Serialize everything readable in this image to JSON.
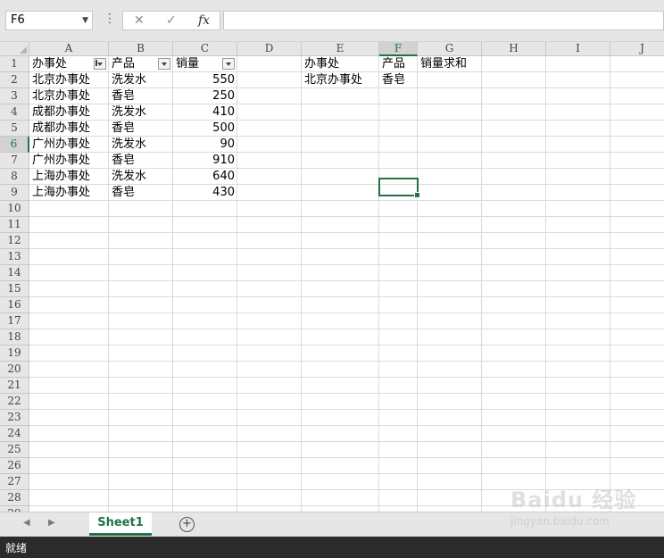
{
  "formula_bar": {
    "name_box": "F6",
    "cancel_icon": "✕",
    "enter_icon": "✓",
    "fx_label": "fx",
    "formula_value": ""
  },
  "columns": [
    "A",
    "B",
    "C",
    "D",
    "E",
    "F",
    "G",
    "H",
    "I",
    "J"
  ],
  "active_column": "F",
  "rows": [
    "1",
    "2",
    "3",
    "4",
    "5",
    "6",
    "7",
    "8",
    "9",
    "10",
    "11",
    "12",
    "13",
    "14",
    "15",
    "16",
    "17",
    "18",
    "19",
    "20",
    "21",
    "22",
    "23",
    "24",
    "25",
    "26",
    "27",
    "28",
    "29"
  ],
  "active_row": "6",
  "selected_cell": "F6",
  "table": {
    "headers": [
      "办事处",
      "产品",
      "销量"
    ],
    "rows": [
      [
        "北京办事处",
        "洗发水",
        "550"
      ],
      [
        "北京办事处",
        "香皂",
        "250"
      ],
      [
        "成都办事处",
        "洗发水",
        "410"
      ],
      [
        "成都办事处",
        "香皂",
        "500"
      ],
      [
        "广州办事处",
        "洗发水",
        "90"
      ],
      [
        "广州办事处",
        "香皂",
        "910"
      ],
      [
        "上海办事处",
        "洗发水",
        "640"
      ],
      [
        "上海办事处",
        "香皂",
        "430"
      ]
    ]
  },
  "criteria": {
    "headers": [
      "办事处",
      "产品",
      "销量求和"
    ],
    "row": [
      "北京办事处",
      "香皂",
      ""
    ]
  },
  "sheet_tabs": [
    {
      "label": "Sheet1",
      "active": true
    }
  ],
  "status_bar": {
    "text": "就绪"
  },
  "watermark": {
    "logo": "Baidu 经验",
    "url": "jingyan.baidu.com"
  },
  "colors": {
    "accent": "#217346",
    "status_bg": "#2b2b2b"
  }
}
